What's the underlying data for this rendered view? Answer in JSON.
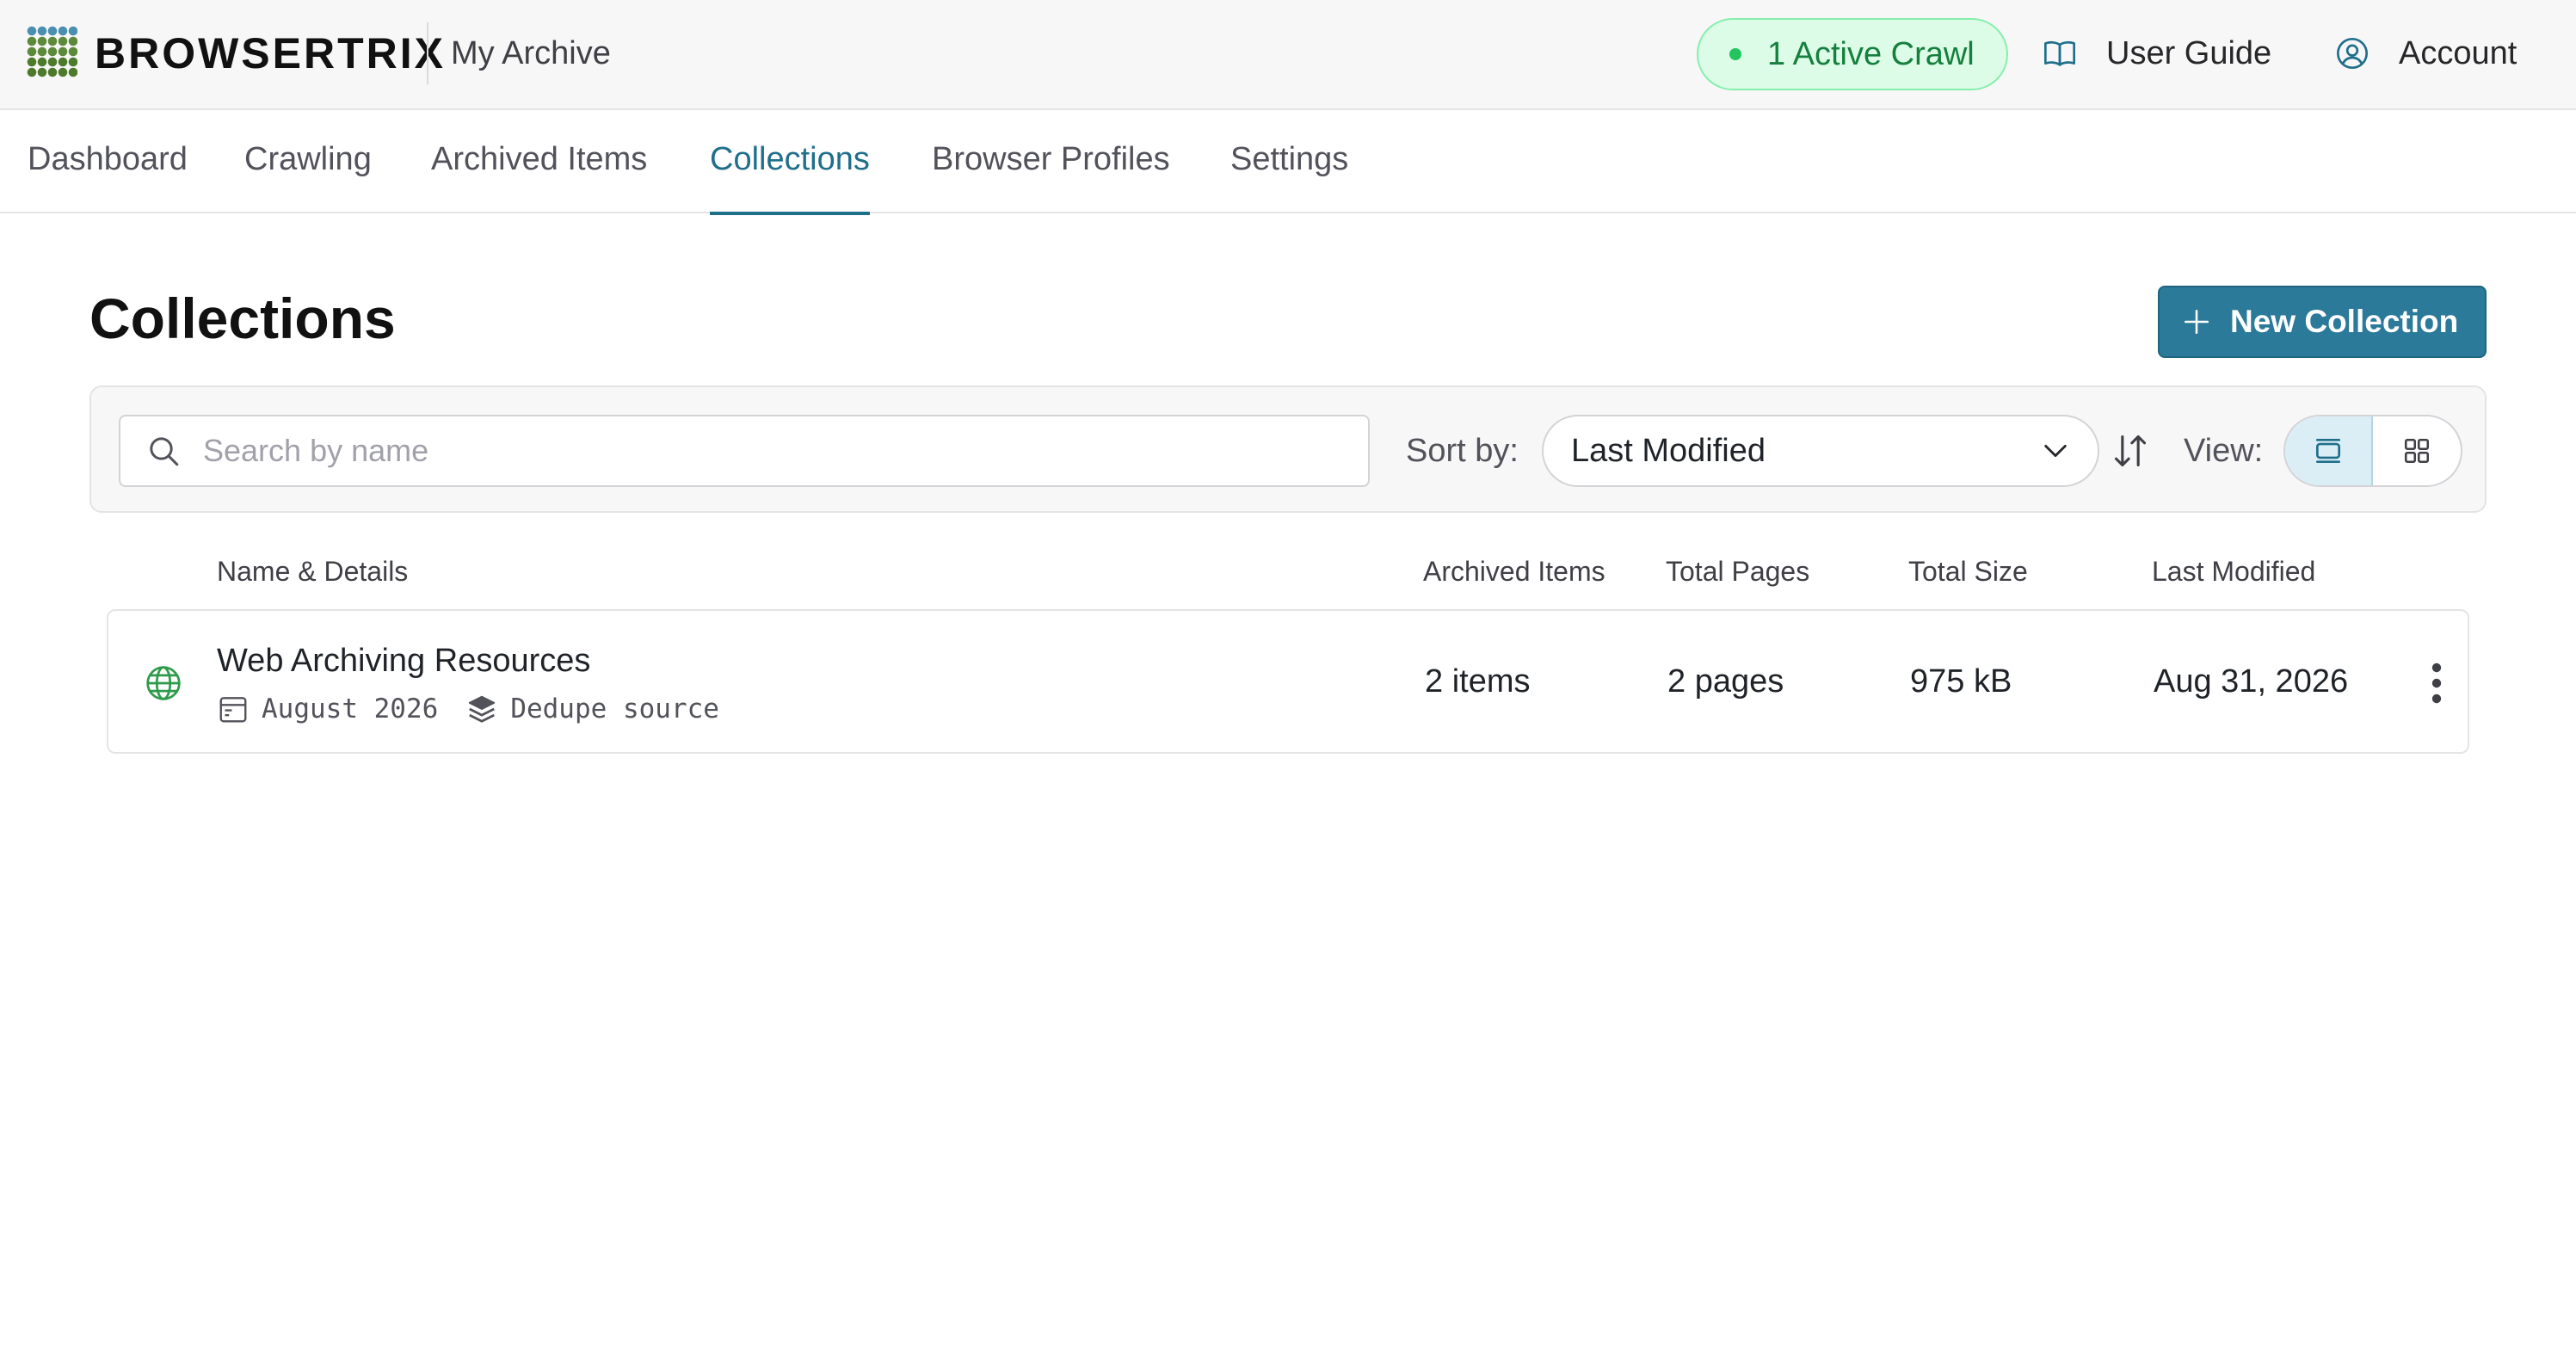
{
  "header": {
    "brand": "BROWSERTRIX",
    "org": "My Archive",
    "active_crawl": "1 Active Crawl",
    "user_guide": "User Guide",
    "account": "Account"
  },
  "nav": {
    "tabs": [
      {
        "label": "Dashboard"
      },
      {
        "label": "Crawling"
      },
      {
        "label": "Archived Items"
      },
      {
        "label": "Collections"
      },
      {
        "label": "Browser Profiles"
      },
      {
        "label": "Settings"
      }
    ],
    "active_tab": "Collections"
  },
  "page": {
    "title": "Collections",
    "new_button": "New Collection"
  },
  "filters": {
    "search_placeholder": "Search by name",
    "sort_label": "Sort by:",
    "sort_value": "Last Modified",
    "view_label": "View:",
    "view_selected": "list"
  },
  "table": {
    "columns": [
      "Name & Details",
      "Archived Items",
      "Total Pages",
      "Total Size",
      "Last Modified"
    ],
    "rows": [
      {
        "name": "Web Archiving Resources",
        "date_range": "August 2026",
        "tag": "Dedupe source",
        "archived_items": "2 items",
        "total_pages": "2 pages",
        "total_size": "975 kB",
        "last_modified": "Aug 31, 2026"
      }
    ]
  },
  "colors": {
    "accent": "#1f6f8b",
    "primary_button": "#2b7a99",
    "active_badge_bg": "#dcfce7",
    "active_badge_text": "#15803d",
    "globe": "#2e9b4a"
  },
  "icons": {
    "logo": "browsertrix-dot-grid-logo",
    "user_guide": "book-icon",
    "account": "user-circle-icon",
    "new": "plus-icon",
    "search": "search-icon",
    "sort_chevron": "chevron-down-icon",
    "sort_direction": "sort-arrows-icon",
    "view_list": "list-view-icon",
    "view_grid": "grid-view-icon",
    "row_status": "globe-icon",
    "date": "calendar-icon",
    "tag": "layers-icon",
    "actions": "kebab-menu-icon"
  }
}
